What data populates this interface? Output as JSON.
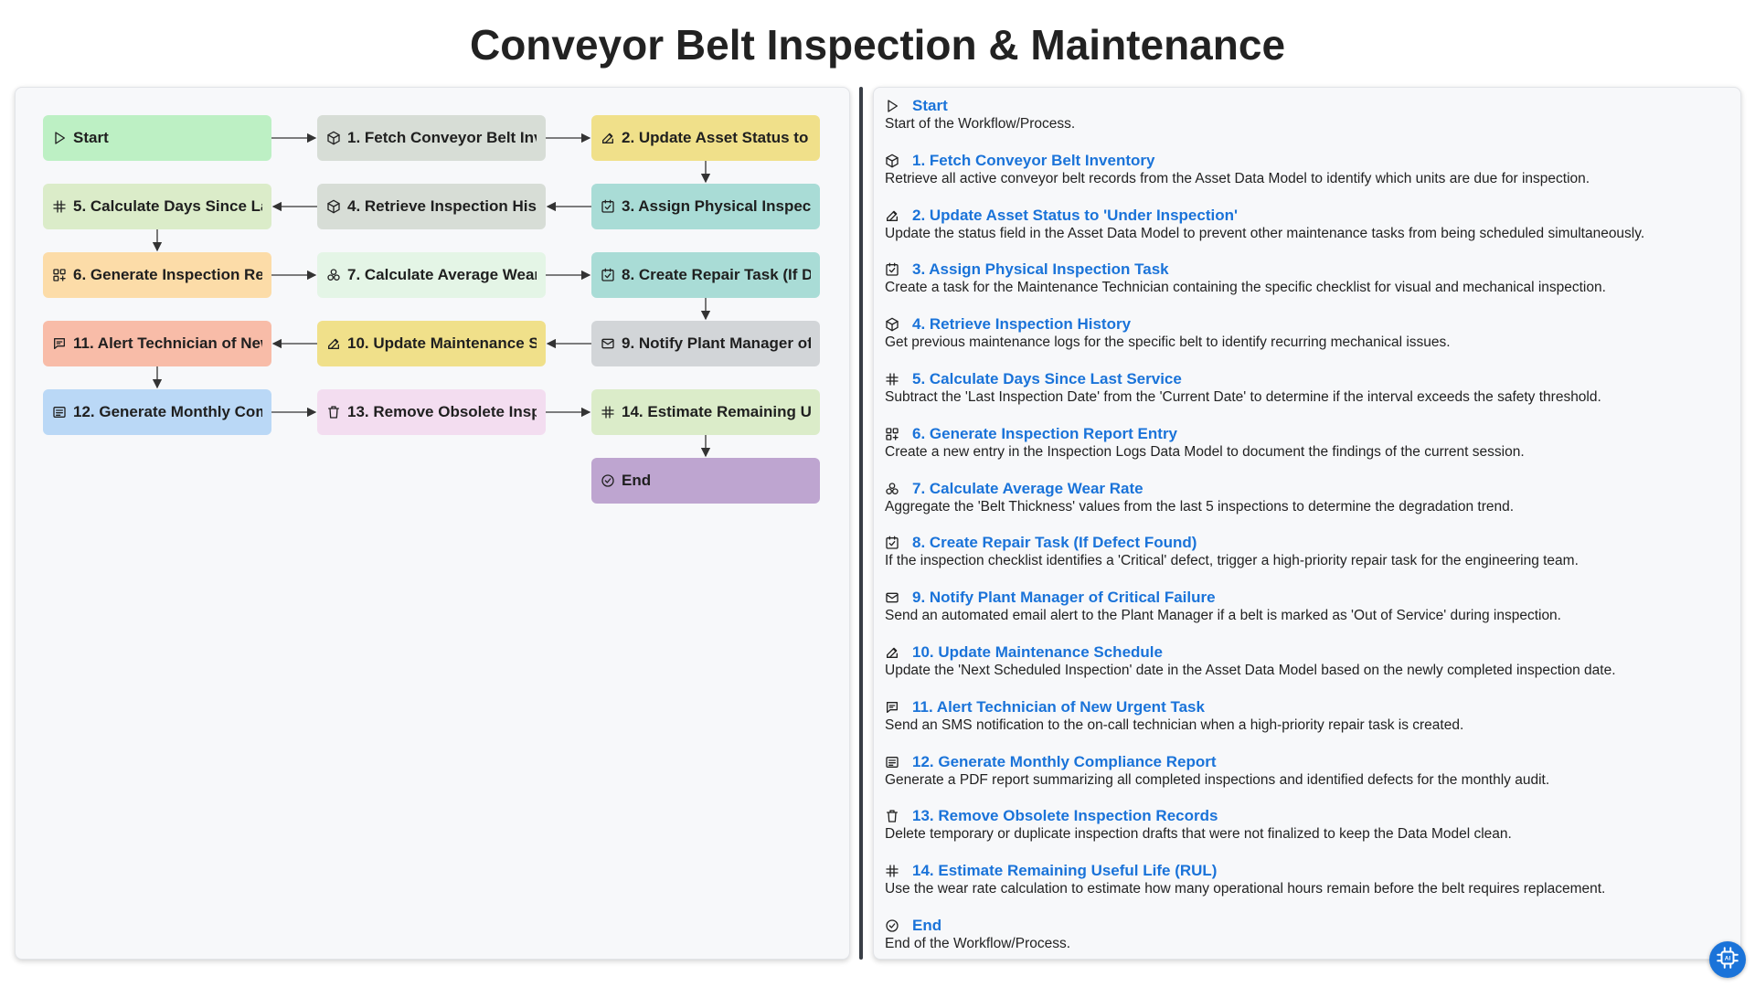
{
  "title": "Conveyor Belt Inspection & Maintenance",
  "nodes": [
    {
      "id": "start",
      "label": "Start",
      "icon": "play-icon",
      "color": "#bdf0c4"
    },
    {
      "id": "n1",
      "label": "1. Fetch Conveyor Belt Inventory",
      "icon": "cube-icon",
      "color": "#d7ddd6"
    },
    {
      "id": "n2",
      "label": "2. Update Asset Status to 'Under Inspection'",
      "icon": "edit-icon",
      "color": "#f0e08a"
    },
    {
      "id": "n3",
      "label": "3. Assign Physical Inspection Task",
      "icon": "checkbox-icon",
      "color": "#a9dcd6"
    },
    {
      "id": "n4",
      "label": "4. Retrieve Inspection History",
      "icon": "cube-icon",
      "color": "#d7ddd6"
    },
    {
      "id": "n5",
      "label": "5. Calculate Days Since Last Service",
      "icon": "hash-icon",
      "color": "#dbecc9"
    },
    {
      "id": "n6",
      "label": "6. Generate Inspection Report Entry",
      "icon": "grid-plus-icon",
      "color": "#fcdca8"
    },
    {
      "id": "n7",
      "label": "7. Calculate Average Wear Rate",
      "icon": "circles-icon",
      "color": "#e4f5e6"
    },
    {
      "id": "n8",
      "label": "8. Create Repair Task (If Defect Found)",
      "icon": "checkbox-icon",
      "color": "#a9dcd6"
    },
    {
      "id": "n9",
      "label": "9. Notify Plant Manager of Critical Failure",
      "icon": "mail-icon",
      "color": "#d2d5d8"
    },
    {
      "id": "n10",
      "label": "10. Update Maintenance Schedule",
      "icon": "edit-icon",
      "color": "#f0e08a"
    },
    {
      "id": "n11",
      "label": "11. Alert Technician of New Urgent Task",
      "icon": "chat-icon",
      "color": "#f8bca8"
    },
    {
      "id": "n12",
      "label": "12. Generate Monthly Compliance Report",
      "icon": "list-icon",
      "color": "#bad8f6"
    },
    {
      "id": "n13",
      "label": "13. Remove Obsolete Inspection Records",
      "icon": "trash-icon",
      "color": "#f3ddf0"
    },
    {
      "id": "n14",
      "label": "14. Estimate Remaining Useful Life (RUL)",
      "icon": "hash-icon",
      "color": "#dbecc9"
    },
    {
      "id": "end",
      "label": "End",
      "icon": "check-circle-icon",
      "color": "#bea5d0"
    }
  ],
  "descriptions": [
    {
      "title": "Start",
      "icon": "play-icon",
      "text": "Start of the Workflow/Process."
    },
    {
      "title": "1. Fetch Conveyor Belt Inventory",
      "icon": "cube-icon",
      "text": "Retrieve all active conveyor belt records from the Asset Data Model to identify which units are due for inspection."
    },
    {
      "title": "2. Update Asset Status to 'Under Inspection'",
      "icon": "edit-icon",
      "text": "Update the status field in the Asset Data Model to prevent other maintenance tasks from being scheduled simultaneously."
    },
    {
      "title": "3. Assign Physical Inspection Task",
      "icon": "checkbox-icon",
      "text": "Create a task for the Maintenance Technician containing the specific checklist for visual and mechanical inspection."
    },
    {
      "title": "4. Retrieve Inspection History",
      "icon": "cube-icon",
      "text": "Get previous maintenance logs for the specific belt to identify recurring mechanical issues."
    },
    {
      "title": "5. Calculate Days Since Last Service",
      "icon": "hash-icon",
      "text": "Subtract the 'Last Inspection Date' from the 'Current Date' to determine if the interval exceeds the safety threshold."
    },
    {
      "title": "6. Generate Inspection Report Entry",
      "icon": "grid-plus-icon",
      "text": "Create a new entry in the Inspection Logs Data Model to document the findings of the current session."
    },
    {
      "title": "7. Calculate Average Wear Rate",
      "icon": "circles-icon",
      "text": "Aggregate the 'Belt Thickness' values from the last 5 inspections to determine the degradation trend."
    },
    {
      "title": "8. Create Repair Task (If Defect Found)",
      "icon": "checkbox-icon",
      "text": "If the inspection checklist identifies a 'Critical' defect, trigger a high-priority repair task for the engineering team."
    },
    {
      "title": "9. Notify Plant Manager of Critical Failure",
      "icon": "mail-icon",
      "text": "Send an automated email alert to the Plant Manager if a belt is marked as 'Out of Service' during inspection."
    },
    {
      "title": "10. Update Maintenance Schedule",
      "icon": "edit-icon",
      "text": "Update the 'Next Scheduled Inspection' date in the Asset Data Model based on the newly completed inspection date."
    },
    {
      "title": "11. Alert Technician of New Urgent Task",
      "icon": "chat-icon",
      "text": "Send an SMS notification to the on-call technician when a high-priority repair task is created."
    },
    {
      "title": "12. Generate Monthly Compliance Report",
      "icon": "list-icon",
      "text": "Generate a PDF report summarizing all completed inspections and identified defects for the monthly audit."
    },
    {
      "title": "13. Remove Obsolete Inspection Records",
      "icon": "trash-icon",
      "text": "Delete temporary or duplicate inspection drafts that were not finalized to keep the Data Model clean."
    },
    {
      "title": "14. Estimate Remaining Useful Life (RUL)",
      "icon": "hash-icon",
      "text": "Use the wear rate calculation to estimate how many operational hours remain before the belt requires replacement."
    },
    {
      "title": "End",
      "icon": "check-circle-icon",
      "text": "End of the Workflow/Process."
    }
  ],
  "fab_icon": "ai-chip-icon"
}
